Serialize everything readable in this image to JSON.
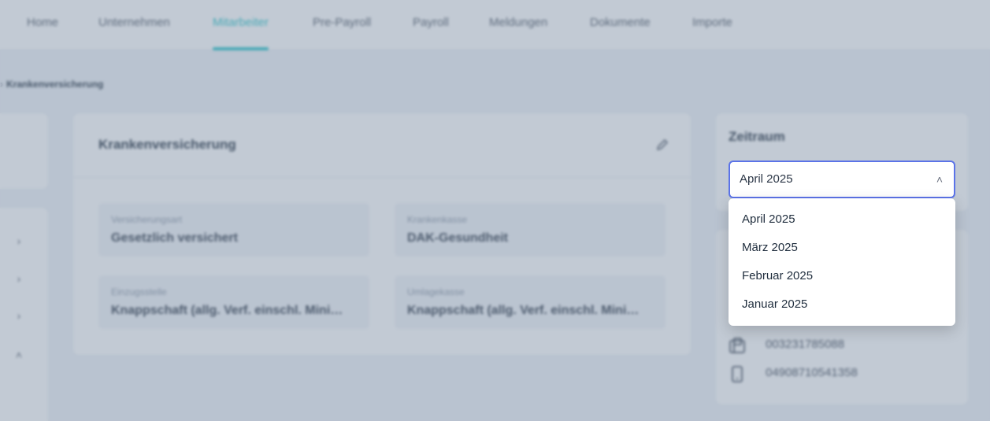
{
  "nav": {
    "items": [
      {
        "label": "Home"
      },
      {
        "label": "Unternehmen"
      },
      {
        "label": "Mitarbeiter"
      },
      {
        "label": "Pre-Payroll"
      },
      {
        "label": "Payroll"
      },
      {
        "label": "Meldungen"
      },
      {
        "label": "Dokumente"
      },
      {
        "label": "Importe"
      }
    ],
    "active": "Mitarbeiter",
    "accent_color": "#22c3c9"
  },
  "breadcrumb": {
    "current": "Krankenversicherung"
  },
  "main": {
    "title": "Krankenversicherung",
    "edit_icon": "pencil-icon",
    "fields": [
      {
        "label": "Versicherungsart",
        "value": "Gesetzlich versichert"
      },
      {
        "label": "Krankenkasse",
        "value": "DAK-Gesundheit"
      },
      {
        "label": "Einzugsstelle",
        "value": "Knappschaft (allg. Verf. einschl. Mini…"
      },
      {
        "label": "Umlagekasse",
        "value": "Knappschaft (allg. Verf. einschl. Mini…"
      }
    ]
  },
  "zeitraum": {
    "title": "Zeitraum",
    "selected": "April 2025",
    "options": [
      "April 2025",
      "März 2025",
      "Februar 2025",
      "Januar 2025"
    ]
  },
  "contact": {
    "items": [
      {
        "icon": "fax-icon",
        "value": "003231785088"
      },
      {
        "icon": "mobile-phone-icon",
        "value": "04908710541358"
      }
    ]
  }
}
